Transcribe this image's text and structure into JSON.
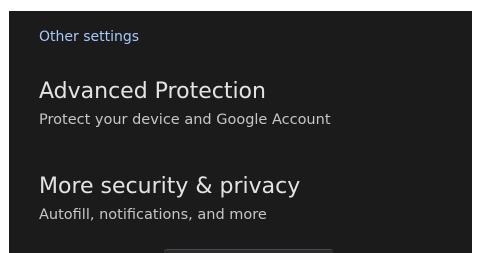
{
  "settings": {
    "section_header": "Other settings",
    "items": [
      {
        "title": "Advanced Protection",
        "subtitle": "Protect your device and Google Account"
      },
      {
        "title": "More security & privacy",
        "subtitle": "Autofill, notifications, and more"
      }
    ]
  },
  "colors": {
    "background": "#1b1b1c",
    "section_header": "#a8c7fa",
    "title": "#e3e3e3",
    "subtitle": "#c4c7c5"
  }
}
